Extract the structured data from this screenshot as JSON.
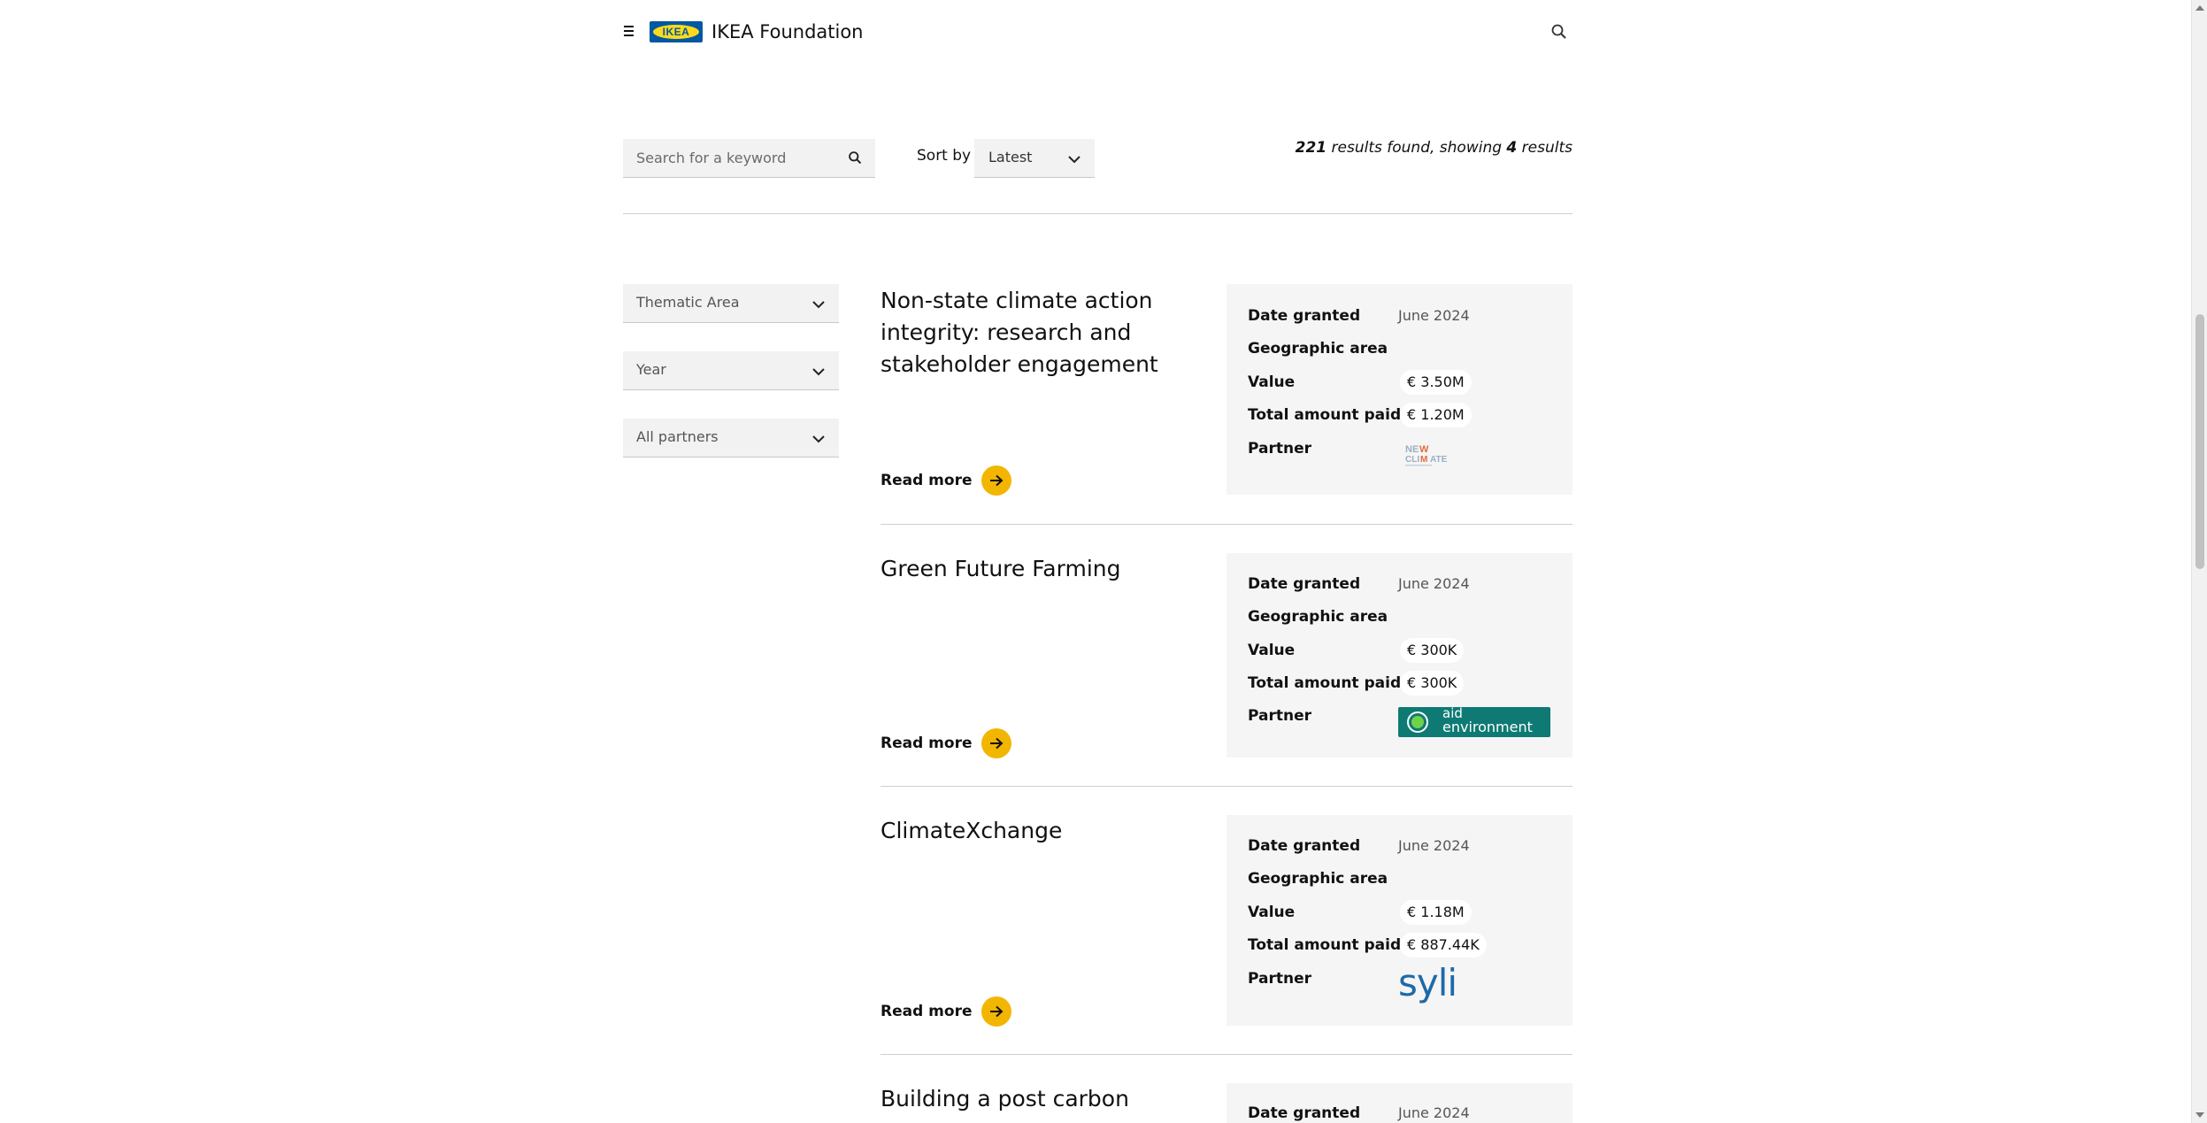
{
  "header": {
    "logo_text": "IKEA",
    "brand": "IKEA Foundation"
  },
  "filters": {
    "keyword_placeholder": "Search for a keyword",
    "sort_label": "Sort by",
    "sort_value": "Latest",
    "results_count": "221",
    "results_mid": " results found, showing ",
    "results_shown": "4",
    "results_tail": " results",
    "sidebar": [
      "Thematic Area",
      "Year",
      "All partners"
    ]
  },
  "labels": {
    "date_granted": "Date granted",
    "geographic_area": "Geographic area",
    "value": "Value",
    "total_amount_paid": "Total amount paid",
    "partner": "Partner",
    "read_more": "Read more"
  },
  "cards": [
    {
      "title": "Non-state climate action integrity: research and stakeholder engagement",
      "date_granted": "June 2024",
      "geographic_area": "",
      "value": "€ 3.50M",
      "total_amount_paid": "€ 1.20M",
      "partner_logo": "NewClimate Institute logo"
    },
    {
      "title": "Green Future Farming",
      "date_granted": "June 2024",
      "geographic_area": "",
      "value": "€ 300K",
      "total_amount_paid": "€ 300K",
      "partner_logo": "aid environment logo",
      "partner_logo_text_1": "aid",
      "partner_logo_text_2": "environment"
    },
    {
      "title": "ClimateXchange",
      "date_granted": "June 2024",
      "geographic_area": "",
      "value": "€ 1.18M",
      "total_amount_paid": "€ 887.44K",
      "partner_logo": "SYLI logo",
      "partner_logo_text": "syli"
    },
    {
      "title": "Building a post carbon",
      "date_granted": "June 2024"
    }
  ],
  "colors": {
    "accent_yellow": "#f2b600",
    "ikea_blue": "#0058a3",
    "ikea_yellow": "#ffda1a",
    "info_panel_bg": "#f5f5f5"
  }
}
